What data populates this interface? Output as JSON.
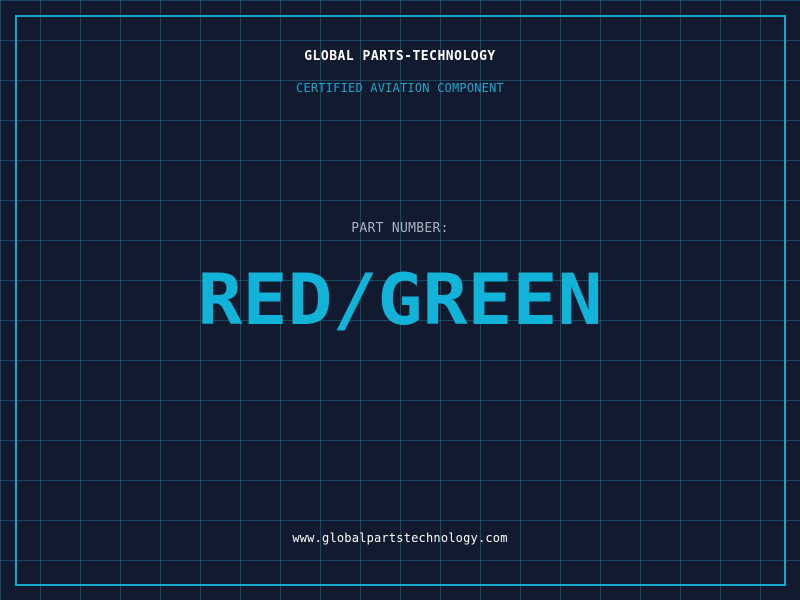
{
  "header": {
    "company_name": "GLOBAL PARTS-TECHNOLOGY",
    "subtitle": "CERTIFIED AVIATION COMPONENT"
  },
  "part": {
    "label": "PART NUMBER:",
    "value": "RED/GREEN"
  },
  "footer": {
    "website": "www.globalpartstechnology.com"
  },
  "colors": {
    "background": "#111a2e",
    "grid": "#226e8c",
    "accent": "#12b3d8",
    "frame": "#14a8cc",
    "label": "#a9b3c2",
    "text": "#ffffff"
  }
}
